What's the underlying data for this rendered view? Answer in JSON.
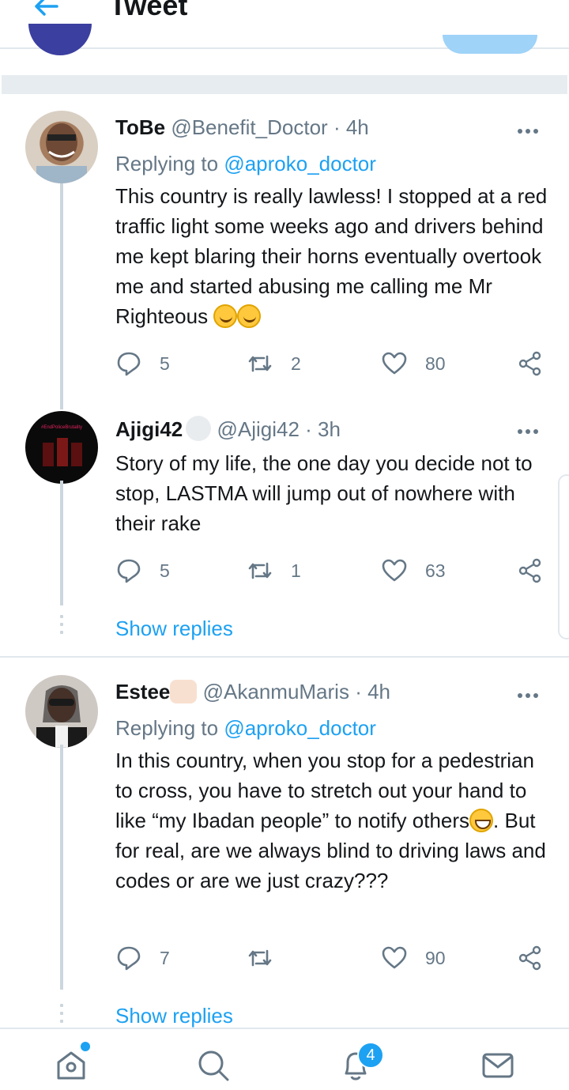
{
  "header": {
    "title": "Tweet"
  },
  "tweets": [
    {
      "name": "ToBe",
      "handle": "@Benefit_Doctor",
      "time": "· 4h",
      "replying_prefix": "Replying to",
      "replying_handle": "@aproko_doctor",
      "text": "This country is really lawless! I stopped at a red traffic light some weeks ago and drivers behind me kept blaring their horns eventually overtook me and started abusing me calling me Mr Righteous",
      "replies": "5",
      "retweets": "2",
      "likes": "80"
    },
    {
      "name": "Ajigi42",
      "handle": "@Ajigi42",
      "time": "· 3h",
      "text": "Story of my life, the one day you decide not to stop, LASTMA will jump out of nowhere with their rake",
      "replies": "5",
      "retweets": "1",
      "likes": "63",
      "show_replies": "Show replies",
      "avatar_text": "#EndPoliceBrutality"
    },
    {
      "name": "Estee",
      "handle": "@AkanmuMaris",
      "time": "· 4h",
      "replying_prefix": "Replying to",
      "replying_handle": "@aproko_doctor",
      "text_part1": "In this country, when you stop for a pedestrian to cross, you have to stretch out your hand to like “my Ibadan people” to notify others",
      "text_part2": ". But for real, are we always blind to driving laws and codes or are we just crazy???",
      "replies": "7",
      "retweets": "",
      "likes": "90",
      "show_replies": "Show replies"
    }
  ],
  "nav": {
    "notifications_badge": "4"
  },
  "colors": {
    "accent": "#1da1f2",
    "muted": "#657786",
    "text": "#14171a",
    "border": "#e1e8ed"
  }
}
